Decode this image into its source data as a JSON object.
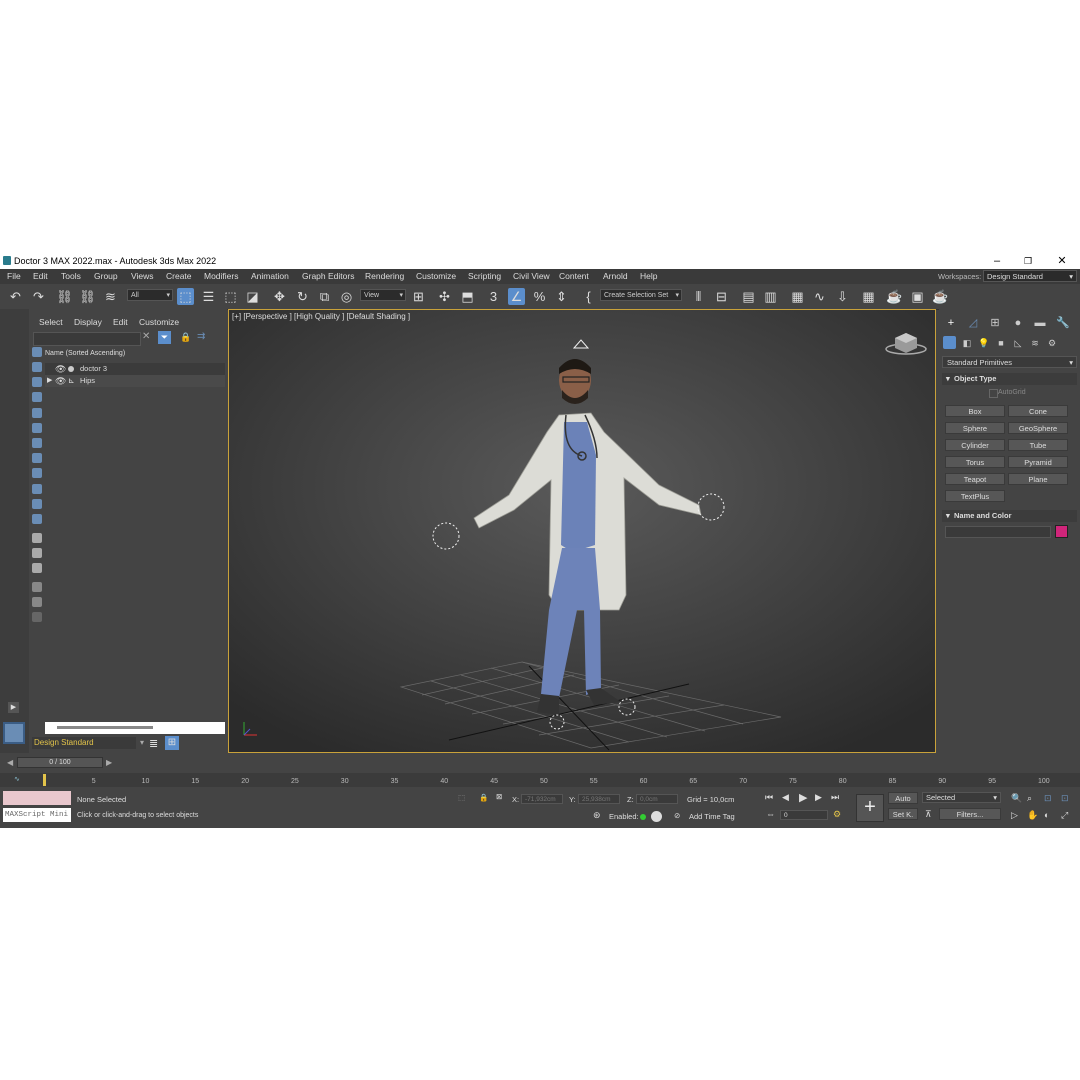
{
  "window": {
    "title": "Doctor 3 MAX 2022.max - Autodesk 3ds Max 2022"
  },
  "menu": [
    "File",
    "Edit",
    "Tools",
    "Group",
    "Views",
    "Create",
    "Modifiers",
    "Animation",
    "Graph Editors",
    "Rendering",
    "Customize",
    "Scripting",
    "Civil View",
    "Content",
    "Arnold",
    "Help"
  ],
  "workspace": {
    "label": "Workspaces:",
    "value": "Design Standard"
  },
  "toolbar": {
    "filter": "All",
    "ref_coord": "View",
    "selection_set": "Create Selection Set"
  },
  "scene_explorer": {
    "tabs": [
      "Select",
      "Display",
      "Edit",
      "Customize"
    ],
    "column": "Name (Sorted Ascending)",
    "rows": [
      {
        "name": "doctor 3"
      },
      {
        "name": "Hips"
      }
    ],
    "workspace": "Design Standard"
  },
  "viewport": {
    "label": "[+] [Perspective ] [High Quality ] [Default Shading ]"
  },
  "command_panel": {
    "category": "Standard Primitives",
    "object_type": "Object Type",
    "autogrid": "AutoGrid",
    "buttons": [
      "Box",
      "Cone",
      "Sphere",
      "GeoSphere",
      "Cylinder",
      "Tube",
      "Torus",
      "Pyramid",
      "Teapot",
      "Plane",
      "TextPlus"
    ],
    "name_color": "Name and Color",
    "color": "#d0257a"
  },
  "timeline": {
    "frame": "0 / 100",
    "ticks": [
      "0",
      "5",
      "10",
      "15",
      "20",
      "25",
      "30",
      "35",
      "40",
      "45",
      "50",
      "55",
      "60",
      "65",
      "70",
      "75",
      "80",
      "85",
      "90",
      "95",
      "100"
    ]
  },
  "status": {
    "maxscript": "MAXScript Mini",
    "selected": "None Selected",
    "hint": "Click or click-and-drag to select objects",
    "x_label": "X:",
    "x": "-71,932cm",
    "y_label": "Y:",
    "y": "25,938cm",
    "z_label": "Z:",
    "z": "0,0cm",
    "grid": "Grid = 10,0cm",
    "enabled": "Enabled:",
    "add_time_tag": "Add Time Tag",
    "auto": "Auto",
    "set_key": "Set K.",
    "selected_dd": "Selected",
    "filters": "Filters...",
    "frame_value": "0"
  }
}
